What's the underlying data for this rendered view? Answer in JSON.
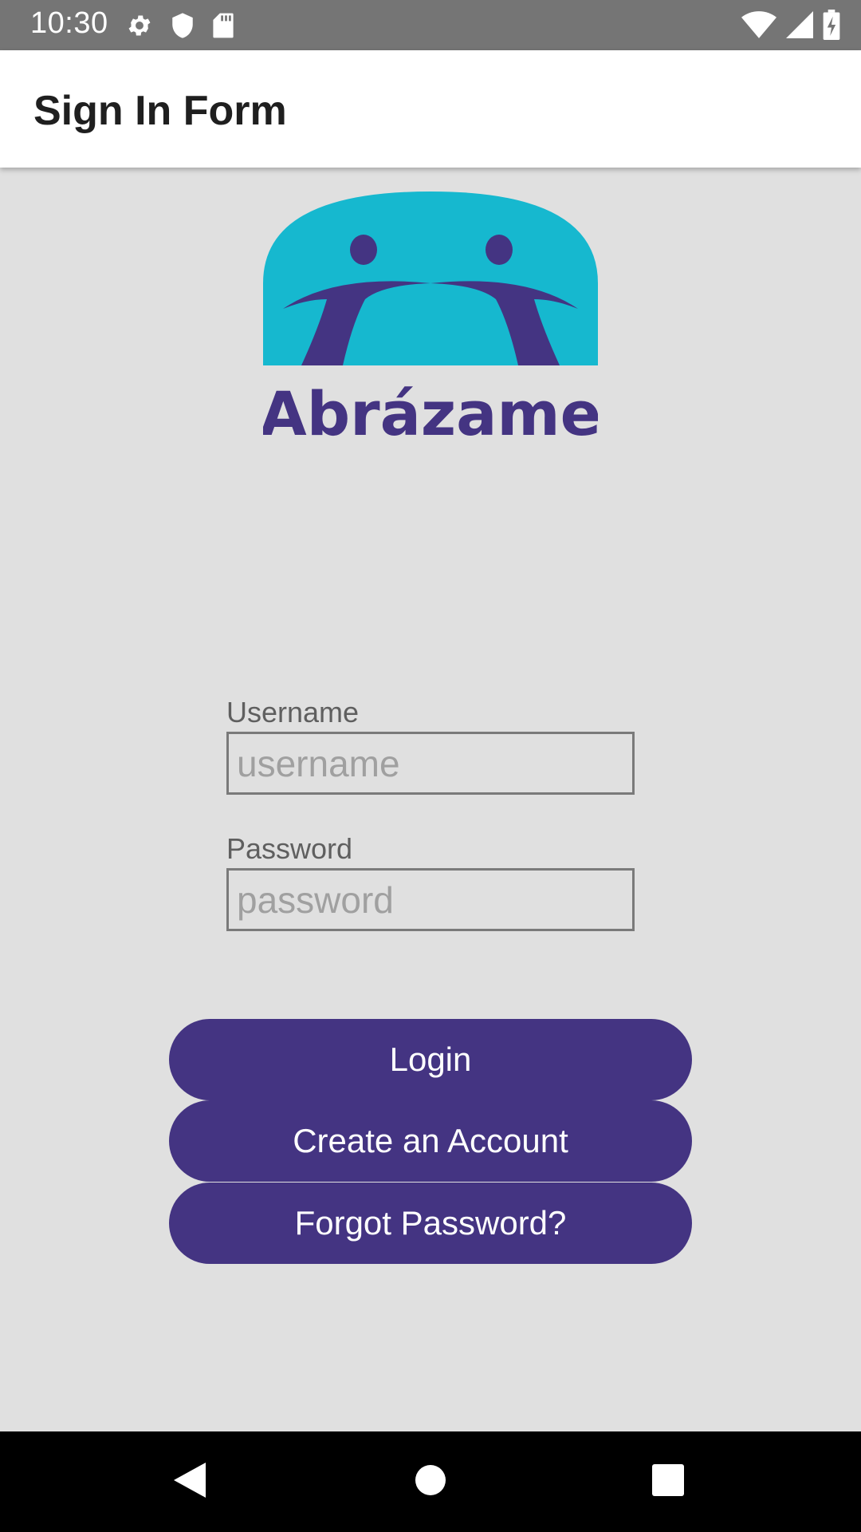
{
  "status_bar": {
    "time": "10:30",
    "left_icons": [
      "settings-icon",
      "shield-icon",
      "sd-card-icon"
    ],
    "right_icons": [
      "wifi-icon",
      "cell-signal-icon",
      "battery-charging-icon"
    ]
  },
  "app_bar": {
    "title": "Sign In Form"
  },
  "logo": {
    "text": "Abrázame",
    "colors": {
      "dome": "#16b8cf",
      "figures": "#443482"
    }
  },
  "form": {
    "username": {
      "label": "Username",
      "placeholder": "username",
      "value": ""
    },
    "password": {
      "label": "Password",
      "placeholder": "password",
      "value": ""
    }
  },
  "buttons": {
    "login": "Login",
    "create_account": "Create an Account",
    "forgot_password": "Forgot Password?"
  },
  "nav_bar": {
    "icons": [
      "back-icon",
      "home-icon",
      "recents-icon"
    ]
  },
  "colors": {
    "primary": "#443482",
    "background": "#e0e0e0",
    "status_bar": "#757575",
    "nav_bar": "#000000"
  }
}
